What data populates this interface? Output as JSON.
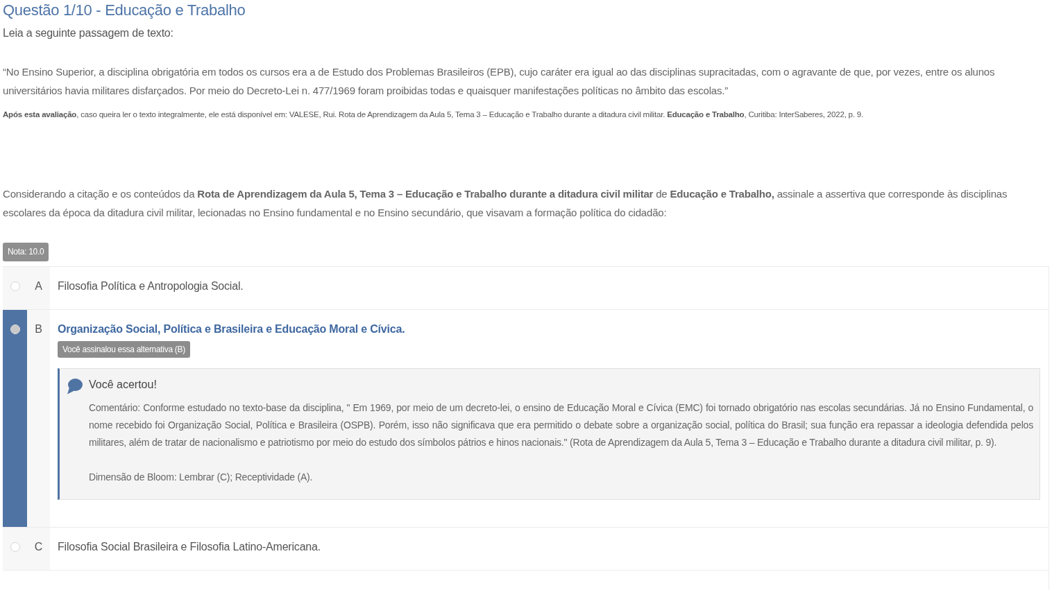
{
  "header": {
    "title": "Questão 1/10 - Educação e Trabalho",
    "instruction": "Leia a seguinte passagem de texto:"
  },
  "passage": {
    "quote": "“No Ensino Superior, a disciplina obrigatória em todos os cursos era a de Estudo dos Problemas Brasileiros (EPB), cujo caráter era igual ao das disciplinas supracitadas, com o agravante de que, por vezes, entre os alunos universitários havia militares disfarçados. Por meio do Decreto-Lei n. 477/1969 foram proibidas todas e quaisquer manifestações políticas no âmbito das escolas.”",
    "source": "**Após esta avaliação**, caso queira ler o texto integralmente, ele está disponível em: VALESE, Rui. Rota de Aprendizagem da Aula 5, Tema 3 – Educação e Trabalho durante a ditadura civil militar. **Educação e Trabalho**, Curitiba: InterSaberes, 2022, p. 9."
  },
  "question": "Considerando a citação e os conteúdos da **Rota de Aprendizagem da Aula 5, Tema 3 – Educação e Trabalho durante a ditadura civil militar** de **Educação e Trabalho,** assinale a assertiva que corresponde às disciplinas escolares da época da ditadura civil militar, lecionadas no Ensino fundamental e no Ensino secundário, que visavam a formação política do cidadão:",
  "grade_badge": "Nota: 10.0",
  "options": [
    {
      "letter": "A",
      "text": "Filosofia Política e Antropologia Social.",
      "selected": false
    },
    {
      "letter": "B",
      "text": "Organização Social, Política e Brasileira e Educação Moral e Cívica.",
      "selected": true,
      "answer_badge": "Você assinalou essa alternativa (B)",
      "feedback": {
        "title": "Você acertou!",
        "comment": "Comentário: Conforme estudado no texto-base da disciplina, \" Em 1969, por meio de um decreto-lei, o ensino de Educação Moral e Cívica (EMC) foi tornado obrigatório nas escolas secundárias. Já no Ensino Fundamental, o nome recebido foi Organização Social, Política e Brasileira (OSPB). Porém, isso não significava que era permitido o debate sobre a organização social, política do Brasil; sua função era repassar a ideologia defendida pelos militares, além de tratar de nacionalismo e patriotismo por meio do estudo dos símbolos pátrios e hinos nacionais.\" (Rota de Aprendizagem da Aula 5, Tema 3 – Educação e Trabalho durante a ditadura civil militar, p. 9).",
        "bloom": "Dimensão de Bloom: Lembrar (C); Receptividade (A)."
      }
    },
    {
      "letter": "C",
      "text": "Filosofia Social Brasileira e Filosofia Latino-Americana.",
      "selected": false
    }
  ]
}
